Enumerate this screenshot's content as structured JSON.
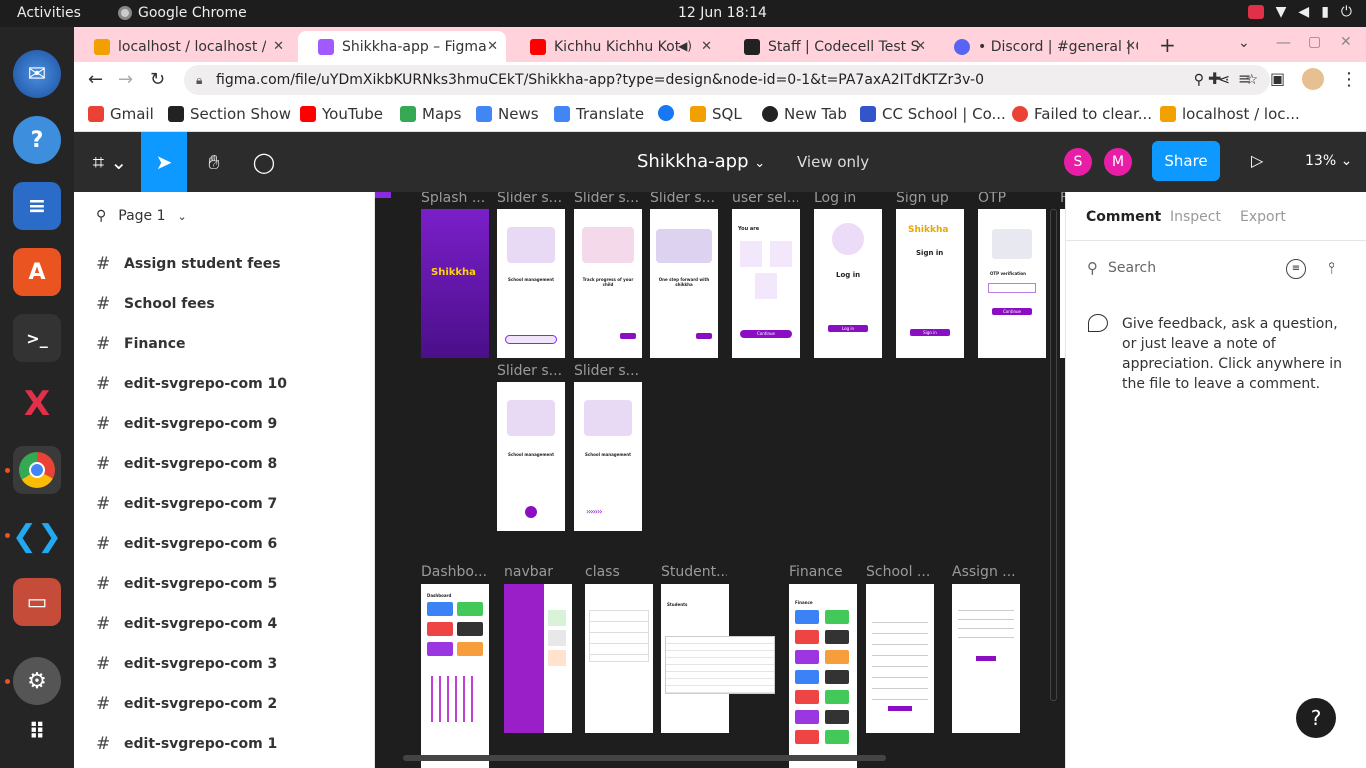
{
  "system": {
    "activities": "Activities",
    "app": "Google Chrome",
    "clock": "12 Jun  18:14"
  },
  "tabs": [
    {
      "title": "localhost / localhost /",
      "color": "#f2a000"
    },
    {
      "title": "Shikkha-app – Figma",
      "color": "#a259ff"
    },
    {
      "title": "Kichhu Kichhu Kot",
      "color": "#ff0000"
    },
    {
      "title": "Staff | Codecell Test S",
      "color": "#222222"
    },
    {
      "title": "• Discord | #general | C",
      "color": "#5865f2"
    }
  ],
  "url": "figma.com/file/uYDmXikbKURNks3hmuCEkT/Shikkha-app?type=design&node-id=0-1&t=PA7axA2ITdKTZr3v-0",
  "bookmarks": [
    {
      "label": "Gmail",
      "color": "#ea4335"
    },
    {
      "label": "Section Show",
      "color": "#222222"
    },
    {
      "label": "YouTube",
      "color": "#ff0000"
    },
    {
      "label": "Maps",
      "color": "#34a853"
    },
    {
      "label": "News",
      "color": "#4285f4"
    },
    {
      "label": "Translate",
      "color": "#4285f4"
    },
    {
      "label": "",
      "color": "#1877f2"
    },
    {
      "label": "SQL",
      "color": "#f2a000"
    },
    {
      "label": "New Tab",
      "color": "#222222"
    },
    {
      "label": "CC School | Co...",
      "color": "#3355cc"
    },
    {
      "label": "Failed to clear...",
      "color": "#ea4335"
    },
    {
      "label": "localhost / loc...",
      "color": "#f2a000"
    }
  ],
  "figma": {
    "file_title": "Shikkha-app",
    "view_only": "View only",
    "avatars": [
      "S",
      "M"
    ],
    "share": "Share",
    "zoom": "13%",
    "page": "Page 1"
  },
  "layers": [
    "Assign student fees",
    "School fees",
    "Finance",
    "edit-svgrepo-com 10",
    "edit-svgrepo-com 9",
    "edit-svgrepo-com 8",
    "edit-svgrepo-com 7",
    "edit-svgrepo-com 6",
    "edit-svgrepo-com 5",
    "edit-svgrepo-com 4",
    "edit-svgrepo-com 3",
    "edit-svgrepo-com 2",
    "edit-svgrepo-com 1"
  ],
  "frames_row1": [
    "Splash ...",
    "Slider s...",
    "Slider s...",
    "Slider s...",
    "user sel...",
    "Log in",
    "Sign up",
    "OTP",
    "F"
  ],
  "frames_row2": [
    "Slider s...",
    "Slider s..."
  ],
  "frames_row3": [
    "Dashbo...",
    "navbar",
    "class",
    "Student...",
    "Finance",
    "School ...",
    "Assign ..."
  ],
  "frame_text": {
    "logo": "Shikkha",
    "slider1": "School management",
    "slider2": "Track progress of your child",
    "slider3": "One step forward with shikkha",
    "user_you_are": "You are",
    "user_continue": "Continue",
    "login_title": "Log in",
    "login_btn": "Log in",
    "signup_title": "Sign in",
    "signup_btn": "Sign in",
    "otp_title": "OTP verification",
    "otp_btn": "Continue",
    "dash_title": "Dashboard",
    "students_title": "Students",
    "finance_title": "Finance"
  },
  "right_panel": {
    "tabs": [
      "Comment",
      "Inspect",
      "Export"
    ],
    "search_placeholder": "Search",
    "feedback": "Give feedback, ask a question, or just leave a note of appreciation. Click anywhere in the file to leave a comment."
  },
  "help": "?"
}
